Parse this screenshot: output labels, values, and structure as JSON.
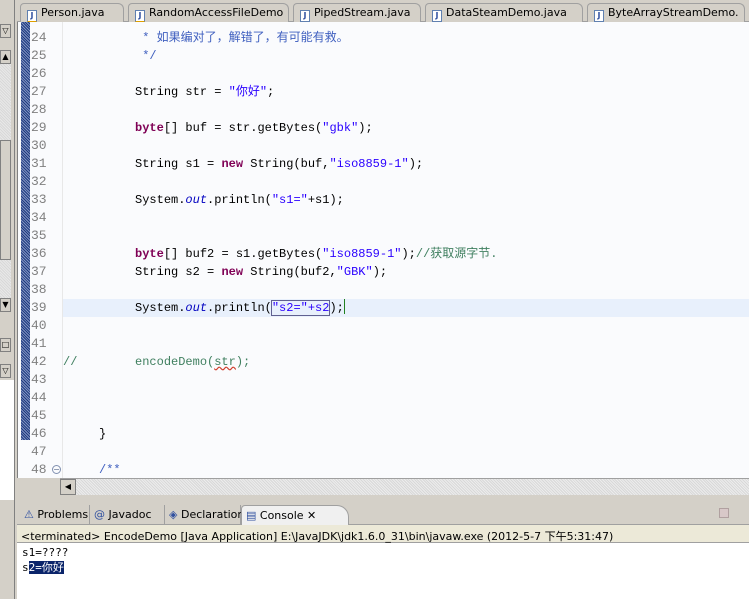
{
  "editor_tabs": [
    {
      "label": "Person.java",
      "warning": true
    },
    {
      "label": "RandomAccessFileDemo",
      "warning": true
    },
    {
      "label": "PipedStream.java",
      "warning": false
    },
    {
      "label": "DataSteamDemo.java",
      "warning": false
    },
    {
      "label": "ByteArrayStreamDemo.",
      "warning": false
    }
  ],
  "code_lines": [
    {
      "n": "24",
      "tokens": [
        [
          "j",
          "           * 如果编对了，解错了，有可能有救。"
        ]
      ]
    },
    {
      "n": "25",
      "tokens": [
        [
          "j",
          "           */"
        ]
      ]
    },
    {
      "n": "26",
      "tokens": []
    },
    {
      "n": "27",
      "tokens": [
        [
          "p",
          "          String str = "
        ],
        [
          "s",
          "\"你好\""
        ],
        [
          "p",
          ";"
        ]
      ]
    },
    {
      "n": "28",
      "tokens": []
    },
    {
      "n": "29",
      "tokens": [
        [
          "p",
          "          "
        ],
        [
          "k",
          "byte"
        ],
        [
          "p",
          "[] buf = str.getBytes("
        ],
        [
          "s",
          "\"gbk\""
        ],
        [
          "p",
          ");"
        ]
      ]
    },
    {
      "n": "30",
      "tokens": []
    },
    {
      "n": "31",
      "tokens": [
        [
          "p",
          "          String s1 = "
        ],
        [
          "k",
          "new"
        ],
        [
          "p",
          " String(buf,"
        ],
        [
          "s",
          "\"iso8859-1\""
        ],
        [
          "p",
          ");"
        ]
      ]
    },
    {
      "n": "32",
      "tokens": []
    },
    {
      "n": "33",
      "tokens": [
        [
          "p",
          "          System."
        ],
        [
          "f",
          "out"
        ],
        [
          "p",
          ".println("
        ],
        [
          "s",
          "\"s1=\""
        ],
        [
          "p",
          "+s1);"
        ]
      ]
    },
    {
      "n": "34",
      "tokens": []
    },
    {
      "n": "35",
      "tokens": []
    },
    {
      "n": "36",
      "tokens": [
        [
          "p",
          "          "
        ],
        [
          "k",
          "byte"
        ],
        [
          "p",
          "[] buf2 = s1.getBytes("
        ],
        [
          "s",
          "\"iso8859-1\""
        ],
        [
          "p",
          ");"
        ],
        [
          "c",
          "//获取源字节."
        ]
      ]
    },
    {
      "n": "37",
      "tokens": [
        [
          "p",
          "          String s2 = "
        ],
        [
          "k",
          "new"
        ],
        [
          "p",
          " String(buf2,"
        ],
        [
          "s",
          "\"GBK\""
        ],
        [
          "p",
          ");"
        ]
      ]
    },
    {
      "n": "38",
      "tokens": []
    },
    {
      "n": "39",
      "current": true,
      "tokens": [
        [
          "p",
          "          System."
        ],
        [
          "f",
          "out"
        ],
        [
          "p",
          ".println("
        ],
        [
          "sbox",
          "\"s2=\"+s2"
        ],
        [
          "p",
          ");"
        ]
      ]
    },
    {
      "n": "40",
      "tokens": []
    },
    {
      "n": "41",
      "tokens": []
    },
    {
      "n": "42",
      "tokens": [
        [
          "c",
          "//        encodeDemo("
        ],
        [
          "csq",
          "str"
        ],
        [
          "c",
          ");"
        ]
      ]
    },
    {
      "n": "43",
      "tokens": []
    },
    {
      "n": "44",
      "tokens": []
    },
    {
      "n": "45",
      "tokens": []
    },
    {
      "n": "46",
      "tokens": [
        [
          "p",
          "     }"
        ]
      ]
    },
    {
      "n": "47",
      "tokens": []
    },
    {
      "n": "48",
      "fold": true,
      "tokens": [
        [
          "j",
          "     /**"
        ]
      ]
    }
  ],
  "panel_tabs": [
    {
      "label": "Problems",
      "icon": "problems-icon"
    },
    {
      "label": "Javadoc",
      "icon": "at-icon"
    },
    {
      "label": "Declaration",
      "icon": "declaration-icon"
    },
    {
      "label": "Console",
      "icon": "console-icon",
      "active": true
    }
  ],
  "console": {
    "status": "<terminated> EncodeDemo [Java Application] E:\\JavaJDK\\jdk1.6.0_31\\bin\\javaw.exe (2012-5-7 下午5:31:47)",
    "line1": "s1=????",
    "line2_prefix": "s",
    "line2_selected": "2=你好"
  },
  "colors": {
    "keyword": "#7f0055",
    "string": "#2a00ff",
    "comment": "#3f7f5f",
    "javadoc": "#3f5fbf",
    "field": "#0000c0",
    "current_line": "#e8f0fc",
    "selection": "#0a246a"
  }
}
